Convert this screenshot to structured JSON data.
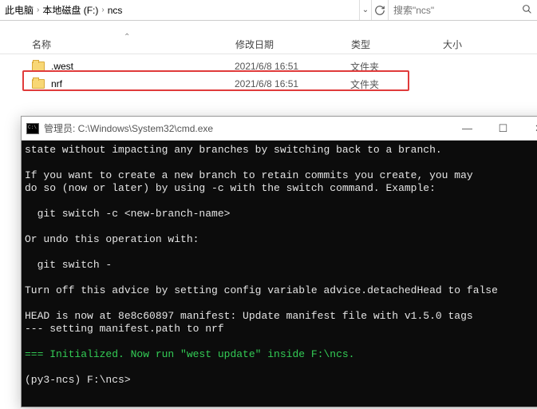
{
  "breadcrumb": {
    "root": "此电脑",
    "drive": "本地磁盘 (F:)",
    "folder": "ncs"
  },
  "search": {
    "placeholder": "搜索\"ncs\""
  },
  "columns": {
    "name": "名称",
    "date": "修改日期",
    "type": "类型",
    "size": "大小"
  },
  "rows": [
    {
      "name": ".west",
      "date": "2021/6/8 16:51",
      "type": "文件夹"
    },
    {
      "name": "nrf",
      "date": "2021/6/8 16:51",
      "type": "文件夹"
    }
  ],
  "terminal": {
    "title": "管理员: C:\\Windows\\System32\\cmd.exe",
    "lines": [
      "state without impacting any branches by switching back to a branch.",
      "",
      "If you want to create a new branch to retain commits you create, you may",
      "do so (now or later) by using -c with the switch command. Example:",
      "",
      "  git switch -c <new-branch-name>",
      "",
      "Or undo this operation with:",
      "",
      "  git switch -",
      "",
      "Turn off this advice by setting config variable advice.detachedHead to false",
      "",
      "HEAD is now at 8e8c60897 manifest: Update manifest file with v1.5.0 tags",
      "--- setting manifest.path to nrf"
    ],
    "initialized": "=== Initialized. Now run \"west update\" inside F:\\ncs.",
    "prompt": "(py3-ncs) F:\\ncs>"
  }
}
